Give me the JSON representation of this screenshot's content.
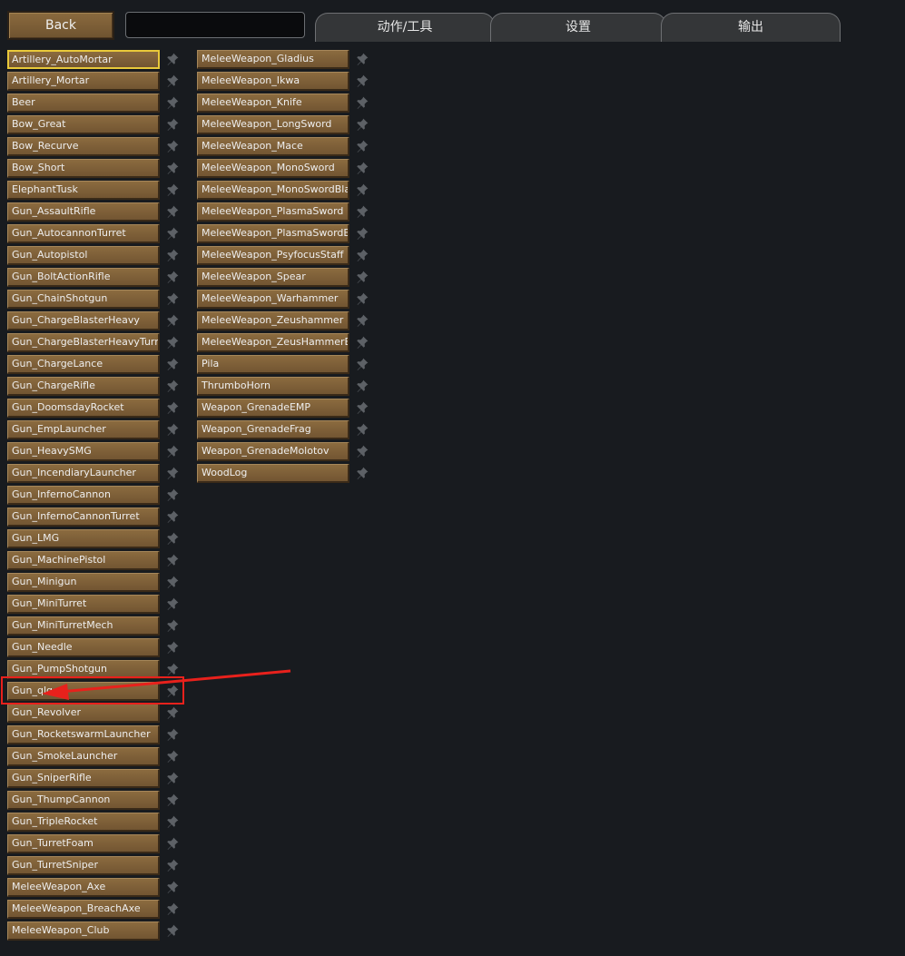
{
  "toolbar": {
    "back_label": "Back",
    "search_value": ""
  },
  "tabs": [
    {
      "label": "动作/工具"
    },
    {
      "label": "设置"
    },
    {
      "label": "输出"
    }
  ],
  "column1": [
    {
      "label": "Artillery_AutoMortar",
      "selected": true
    },
    {
      "label": "Artillery_Mortar"
    },
    {
      "label": "Beer"
    },
    {
      "label": "Bow_Great"
    },
    {
      "label": "Bow_Recurve"
    },
    {
      "label": "Bow_Short"
    },
    {
      "label": "ElephantTusk"
    },
    {
      "label": "Gun_AssaultRifle"
    },
    {
      "label": "Gun_AutocannonTurret"
    },
    {
      "label": "Gun_Autopistol"
    },
    {
      "label": "Gun_BoltActionRifle"
    },
    {
      "label": "Gun_ChainShotgun"
    },
    {
      "label": "Gun_ChargeBlasterHeavy"
    },
    {
      "label": "Gun_ChargeBlasterHeavyTurret"
    },
    {
      "label": "Gun_ChargeLance"
    },
    {
      "label": "Gun_ChargeRifle"
    },
    {
      "label": "Gun_DoomsdayRocket"
    },
    {
      "label": "Gun_EmpLauncher"
    },
    {
      "label": "Gun_HeavySMG"
    },
    {
      "label": "Gun_IncendiaryLauncher"
    },
    {
      "label": "Gun_InfernoCannon"
    },
    {
      "label": "Gun_InfernoCannonTurret"
    },
    {
      "label": "Gun_LMG"
    },
    {
      "label": "Gun_MachinePistol"
    },
    {
      "label": "Gun_Minigun"
    },
    {
      "label": "Gun_MiniTurret"
    },
    {
      "label": "Gun_MiniTurretMech"
    },
    {
      "label": "Gun_Needle"
    },
    {
      "label": "Gun_PumpShotgun"
    },
    {
      "label": "Gun_qlq"
    },
    {
      "label": "Gun_Revolver"
    },
    {
      "label": "Gun_RocketswarmLauncher"
    },
    {
      "label": "Gun_SmokeLauncher"
    },
    {
      "label": "Gun_SniperRifle"
    },
    {
      "label": "Gun_ThumpCannon"
    },
    {
      "label": "Gun_TripleRocket"
    },
    {
      "label": "Gun_TurretFoam"
    },
    {
      "label": "Gun_TurretSniper"
    },
    {
      "label": "MeleeWeapon_Axe"
    },
    {
      "label": "MeleeWeapon_BreachAxe"
    },
    {
      "label": "MeleeWeapon_Club"
    }
  ],
  "column2": [
    {
      "label": "MeleeWeapon_Gladius"
    },
    {
      "label": "MeleeWeapon_Ikwa"
    },
    {
      "label": "MeleeWeapon_Knife"
    },
    {
      "label": "MeleeWeapon_LongSword"
    },
    {
      "label": "MeleeWeapon_Mace"
    },
    {
      "label": "MeleeWeapon_MonoSword"
    },
    {
      "label": "MeleeWeapon_MonoSwordBlade"
    },
    {
      "label": "MeleeWeapon_PlasmaSword"
    },
    {
      "label": "MeleeWeapon_PlasmaSwordBlade"
    },
    {
      "label": "MeleeWeapon_PsyfocusStaff"
    },
    {
      "label": "MeleeWeapon_Spear"
    },
    {
      "label": "MeleeWeapon_Warhammer"
    },
    {
      "label": "MeleeWeapon_Zeushammer"
    },
    {
      "label": "MeleeWeapon_ZeusHammerBlade"
    },
    {
      "label": "Pila"
    },
    {
      "label": "ThrumboHorn"
    },
    {
      "label": "Weapon_GrenadeEMP"
    },
    {
      "label": "Weapon_GrenadeFrag"
    },
    {
      "label": "Weapon_GrenadeMolotov"
    },
    {
      "label": "WoodLog"
    }
  ],
  "pin_icon": "pin-icon",
  "colors": {
    "background": "#181b1f",
    "button": "#7d5f38",
    "selected_border": "#e9c93a",
    "annotation": "#e8211c"
  }
}
